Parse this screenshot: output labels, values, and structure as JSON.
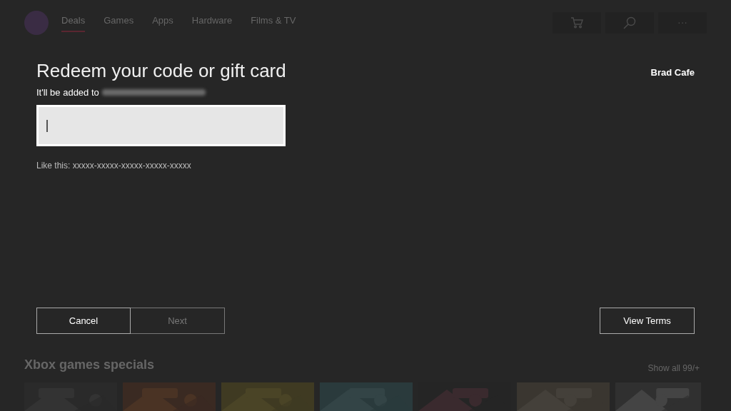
{
  "nav": {
    "tabs": [
      {
        "label": "Deals",
        "selected": true
      },
      {
        "label": "Games",
        "selected": false
      },
      {
        "label": "Apps",
        "selected": false
      },
      {
        "label": "Hardware",
        "selected": false
      },
      {
        "label": "Films & TV",
        "selected": false
      }
    ],
    "buttons": [
      {
        "kind": "cart"
      },
      {
        "kind": "search"
      },
      {
        "kind": "more",
        "label": "···"
      }
    ]
  },
  "dialog": {
    "title": "Redeem your code or gift card",
    "account": "Brad Cafe",
    "subtitle": "It'll be added to",
    "code_field": {
      "focused": true
    },
    "hint": "Like this: xxxxx-xxxxx-xxxxx-xxxxx-xxxxx",
    "buttons": [
      {
        "label": "Cancel",
        "disabled": false
      },
      {
        "label": "Next",
        "disabled": true
      }
    ],
    "terms_button": "View Terms"
  },
  "section": {
    "title": "Xbox games specials",
    "link": "Show all 99/+"
  }
}
